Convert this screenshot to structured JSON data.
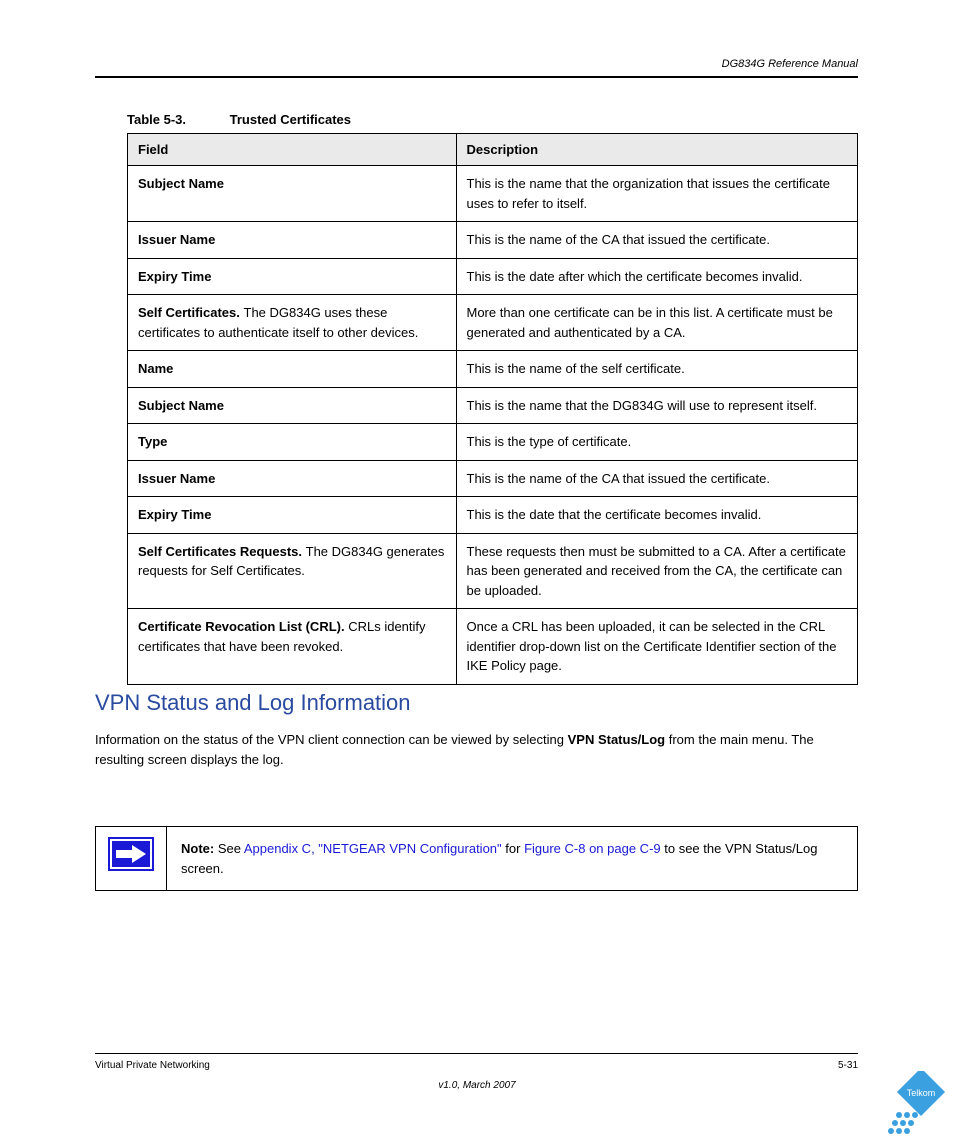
{
  "header": {
    "text": "DG834G Reference Manual"
  },
  "table1": {
    "caption": "Table 5-3.",
    "caption_suffix": "Trusted Certificates",
    "headers": [
      "Field",
      "Description"
    ],
    "rows": [
      {
        "col1_strong": "Subject Name",
        "col1_rest": "",
        "col2": "This is the name that the organization that issues the certificate uses to refer to itself."
      },
      {
        "col1_strong": "Issuer Name",
        "col1_rest": "",
        "col2": "This is the name of the CA that issued the certificate."
      },
      {
        "col1_strong": "Expiry Time",
        "col1_rest": "",
        "col2": "This is the date after which the certificate becomes invalid."
      },
      {
        "col1_strong": "Self Certificates. ",
        "col1_rest": "The DG834G uses these certificates to authenticate itself to other devices.",
        "col2": "More than one certificate can be in this list. A certificate must be generated and authenticated by a CA."
      },
      {
        "col1_strong": "Name",
        "col1_rest": "",
        "col2": "This is the name of the self certificate."
      },
      {
        "col1_strong": "Subject Name",
        "col1_rest": "",
        "col2": "This is the name that the DG834G will use to represent itself."
      },
      {
        "col1_strong": "Type",
        "col1_rest": "",
        "col2": "This is the type of certificate."
      },
      {
        "col1_strong": "Issuer Name",
        "col1_rest": "",
        "col2": "This is the name of the CA that issued the certificate."
      },
      {
        "col1_strong": "Expiry Time",
        "col1_rest": "",
        "col2": "This is the date that the certificate becomes invalid."
      },
      {
        "col1_strong": "Self Certificates Requests. ",
        "col1_rest": "The DG834G generates requests for Self Certificates.",
        "col2": "These requests then must be submitted to a CA. After a certificate has been generated and received from the CA, the certificate can be uploaded."
      },
      {
        "col1_strong": "Certificate Revocation List (CRL). ",
        "col1_rest": "CRLs identify certificates that have been revoked.",
        "col2": "Once a CRL has been uploaded, it can be selected in the CRL identifier drop-down list on the Certificate Identifier section of the IKE Policy page."
      }
    ]
  },
  "section": {
    "heading": "VPN Status and Log Information"
  },
  "body": {
    "p1_prefix": "Information on the status of the VPN client connection can be viewed by selecting ",
    "p1_bold": "VPN Status/Log",
    "p1_suffix": " from the main menu. The resulting screen displays the log."
  },
  "note": {
    "label": "Note:",
    "text_prefix": " See ",
    "text_link1": "Appendix C, \"NETGEAR VPN Configuration\"",
    "text_mid": " for ",
    "text_link2": "Figure C-8 on page C-9",
    "text_suffix": " to see the VPN Status/Log screen."
  },
  "footer": {
    "left": "Virtual Private Networking",
    "right_prefix": "5-31",
    "version": "v1.0, March 2007"
  },
  "logo": {
    "brand": "Telkom"
  }
}
